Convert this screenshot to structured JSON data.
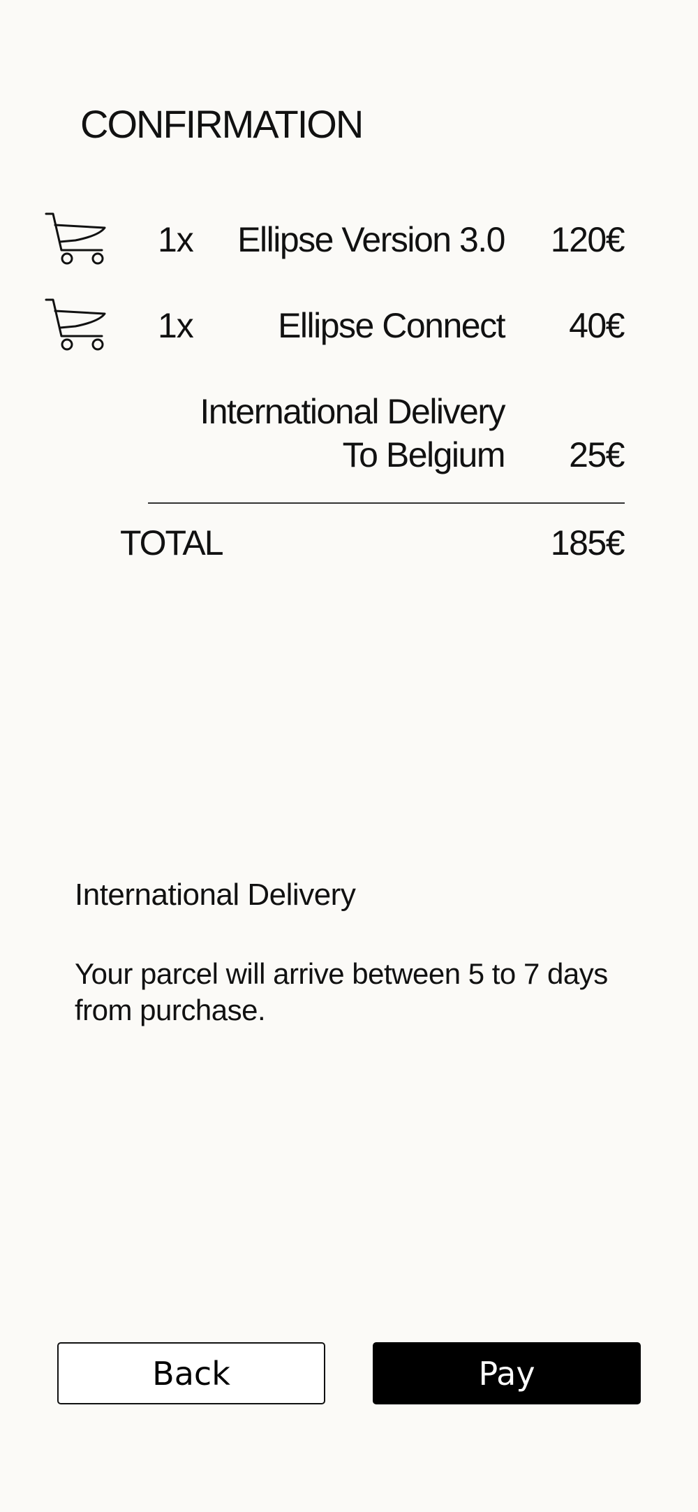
{
  "header": {
    "title": "CONFIRMATION"
  },
  "order": {
    "items": [
      {
        "icon": "cart-icon",
        "quantity": "1x",
        "name": "Ellipse Version 3.0",
        "price": "120€"
      },
      {
        "icon": "cart-icon",
        "quantity": "1x",
        "name": "Ellipse Connect",
        "price": "40€"
      }
    ],
    "delivery": {
      "line1": "International Delivery",
      "line2": "To Belgium",
      "price": "25€"
    },
    "total": {
      "label": "TOTAL",
      "price": "185€"
    }
  },
  "info": {
    "title": "International Delivery",
    "text": "Your parcel will arrive between 5 to 7 days from purchase."
  },
  "actions": {
    "back_label": "Back",
    "pay_label": "Pay"
  },
  "colors": {
    "background": "#fbfaf7",
    "text": "#111111",
    "pay_button": "#000000"
  }
}
